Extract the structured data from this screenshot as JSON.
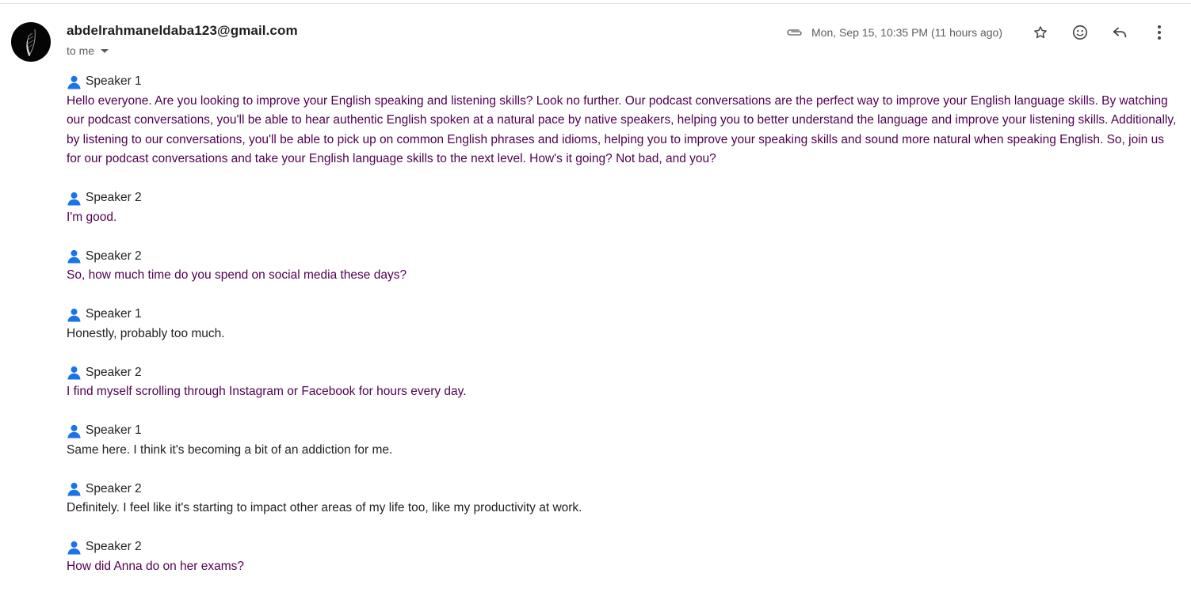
{
  "header": {
    "sender": "abdelrahmaneldaba123@gmail.com",
    "recipient_label": "to me",
    "date": "Mon, Sep 15, 10:35 PM (11 hours ago)"
  },
  "icons": {
    "attachment": "paperclip-icon",
    "star": "star-icon",
    "emoji": "emoji-reaction-icon",
    "reply": "reply-icon",
    "more": "more-vert-icon",
    "speaker": "person-icon"
  },
  "colors": {
    "quoted_text": "#500050",
    "body_text": "#222222",
    "person_icon": "#1a73e8"
  },
  "messages": [
    {
      "speaker": "Speaker 1",
      "text": "Hello everyone. Are you looking to improve your English speaking and listening skills? Look no further. Our podcast conversations are the perfect way to improve your English language skills. By watching our podcast conversations, you'll be able to hear authentic English spoken at a natural pace by native speakers, helping you to better understand the language and improve your listening skills. Additionally, by listening to our conversations, you'll be able to pick up on common English phrases and idioms, helping you to improve your speaking skills and sound more natural when speaking English. So, join us for our podcast conversations and take your English language skills to the next level. How's it going? Not bad, and you?",
      "tone": "purple"
    },
    {
      "speaker": "Speaker 2",
      "text": "I'm good.",
      "tone": "purple"
    },
    {
      "speaker": "Speaker 2",
      "text": "So, how much time do you spend on social media these days?",
      "tone": "purple"
    },
    {
      "speaker": "Speaker 1",
      "text": "Honestly, probably too much.",
      "tone": "dark"
    },
    {
      "speaker": "Speaker 2",
      "text": "I find myself scrolling through Instagram or Facebook for hours every day.",
      "tone": "purple"
    },
    {
      "speaker": "Speaker 1",
      "text": "Same here. I think it's becoming a bit of an addiction for me.",
      "tone": "dark"
    },
    {
      "speaker": "Speaker 2",
      "text": "Definitely. I feel like it's starting to impact other areas of my life too, like my productivity at work.",
      "tone": "dark"
    },
    {
      "speaker": "Speaker 2",
      "text": "How did Anna do on her exams?",
      "tone": "purple"
    }
  ]
}
